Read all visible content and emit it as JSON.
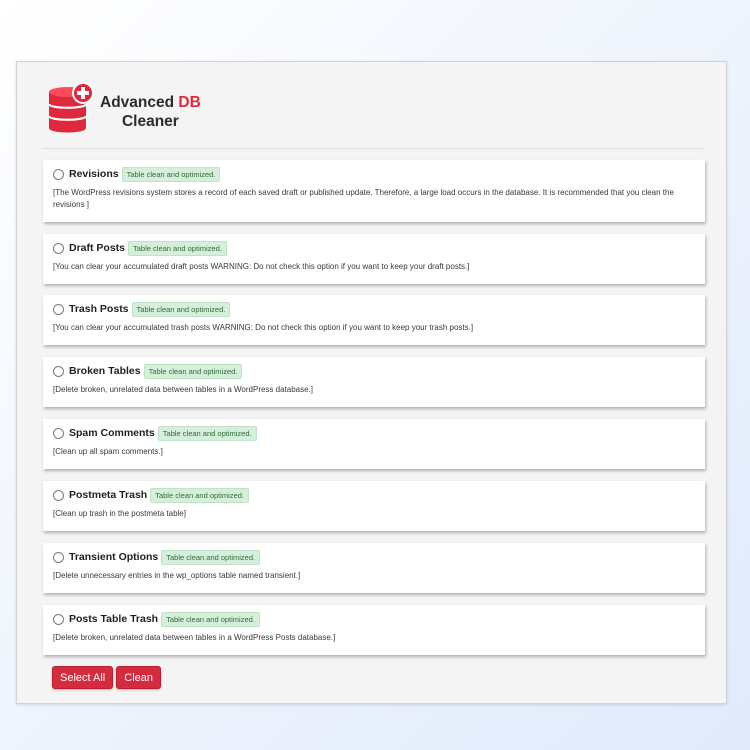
{
  "logo": {
    "line1": "Advanced",
    "line1_accent": "DB",
    "line2": "Cleaner",
    "icon": "database-plus-icon"
  },
  "colors": {
    "accent": "#e0283c",
    "button": "#d42b3f",
    "badge_bg": "#d6efdb",
    "badge_text": "#2f6b3a"
  },
  "options": [
    {
      "title": "Revisions",
      "badge": "Table clean and optimized.",
      "description": "[The WordPress revisions system stores a record of each saved draft or published update. Therefore, a large load occurs in the database. It is recommended that you clean the revisions ]",
      "checked": false
    },
    {
      "title": "Draft Posts",
      "badge": "Table clean and optimized.",
      "description": "[You can clear your accumulated draft posts WARNING: Do not check this option if you want to keep your draft posts.]",
      "checked": false
    },
    {
      "title": "Trash Posts",
      "badge": "Table clean and optimized.",
      "description": "[You can clear your accumulated trash posts WARNING: Do not check this option if you want to keep your trash posts.]",
      "checked": false
    },
    {
      "title": "Broken Tables",
      "badge": "Table clean and optimized.",
      "description": "[Delete broken, unrelated data between tables in a WordPress database.]",
      "checked": false
    },
    {
      "title": "Spam Comments",
      "badge": "Table clean and optimized.",
      "description": "[Clean up all spam comments.]",
      "checked": false
    },
    {
      "title": "Postmeta Trash",
      "badge": "Table clean and optimized.",
      "description": "[Clean up trash in the postmeta table]",
      "checked": false
    },
    {
      "title": "Transient Options",
      "badge": "Table clean and optimized.",
      "description": "[Delete unnecessary entries in the wp_options table named transient.]",
      "checked": false
    },
    {
      "title": "Posts Table Trash",
      "badge": "Table clean and optimized.",
      "description": "[Delete broken, unrelated data between tables in a WordPress Posts database.]",
      "checked": false
    }
  ],
  "buttons": {
    "select_all": "Select All",
    "clean": "Clean"
  }
}
